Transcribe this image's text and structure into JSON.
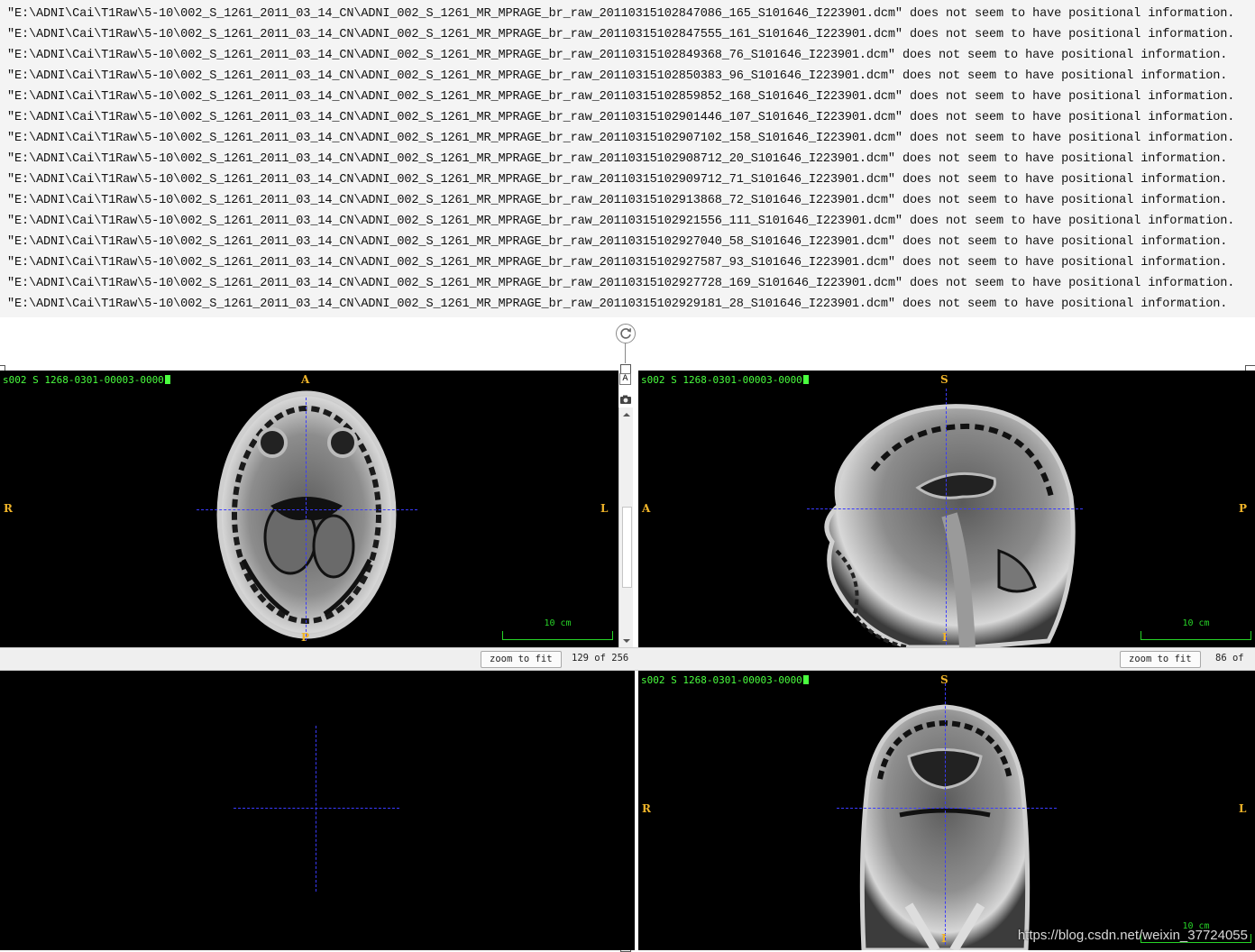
{
  "log": {
    "lines": [
      "\"E:\\ADNI\\Cai\\T1Raw\\5-10\\002_S_1261_2011_03_14_CN\\ADNI_002_S_1261_MR_MPRAGE_br_raw_20110315102847086_165_S101646_I223901.dcm\" does not seem to have positional information.",
      "\"E:\\ADNI\\Cai\\T1Raw\\5-10\\002_S_1261_2011_03_14_CN\\ADNI_002_S_1261_MR_MPRAGE_br_raw_20110315102847555_161_S101646_I223901.dcm\" does not seem to have positional information.",
      "\"E:\\ADNI\\Cai\\T1Raw\\5-10\\002_S_1261_2011_03_14_CN\\ADNI_002_S_1261_MR_MPRAGE_br_raw_20110315102849368_76_S101646_I223901.dcm\" does not seem to have positional information.",
      "\"E:\\ADNI\\Cai\\T1Raw\\5-10\\002_S_1261_2011_03_14_CN\\ADNI_002_S_1261_MR_MPRAGE_br_raw_20110315102850383_96_S101646_I223901.dcm\" does not seem to have positional information.",
      "\"E:\\ADNI\\Cai\\T1Raw\\5-10\\002_S_1261_2011_03_14_CN\\ADNI_002_S_1261_MR_MPRAGE_br_raw_20110315102859852_168_S101646_I223901.dcm\" does not seem to have positional information.",
      "\"E:\\ADNI\\Cai\\T1Raw\\5-10\\002_S_1261_2011_03_14_CN\\ADNI_002_S_1261_MR_MPRAGE_br_raw_20110315102901446_107_S101646_I223901.dcm\" does not seem to have positional information.",
      "\"E:\\ADNI\\Cai\\T1Raw\\5-10\\002_S_1261_2011_03_14_CN\\ADNI_002_S_1261_MR_MPRAGE_br_raw_20110315102907102_158_S101646_I223901.dcm\" does not seem to have positional information.",
      "\"E:\\ADNI\\Cai\\T1Raw\\5-10\\002_S_1261_2011_03_14_CN\\ADNI_002_S_1261_MR_MPRAGE_br_raw_20110315102908712_20_S101646_I223901.dcm\" does not seem to have positional information.",
      "\"E:\\ADNI\\Cai\\T1Raw\\5-10\\002_S_1261_2011_03_14_CN\\ADNI_002_S_1261_MR_MPRAGE_br_raw_20110315102909712_71_S101646_I223901.dcm\" does not seem to have positional information.",
      "\"E:\\ADNI\\Cai\\T1Raw\\5-10\\002_S_1261_2011_03_14_CN\\ADNI_002_S_1261_MR_MPRAGE_br_raw_20110315102913868_72_S101646_I223901.dcm\" does not seem to have positional information.",
      "\"E:\\ADNI\\Cai\\T1Raw\\5-10\\002_S_1261_2011_03_14_CN\\ADNI_002_S_1261_MR_MPRAGE_br_raw_20110315102921556_111_S101646_I223901.dcm\" does not seem to have positional information.",
      "\"E:\\ADNI\\Cai\\T1Raw\\5-10\\002_S_1261_2011_03_14_CN\\ADNI_002_S_1261_MR_MPRAGE_br_raw_20110315102927040_58_S101646_I223901.dcm\" does not seem to have positional information.",
      "\"E:\\ADNI\\Cai\\T1Raw\\5-10\\002_S_1261_2011_03_14_CN\\ADNI_002_S_1261_MR_MPRAGE_br_raw_20110315102927587_93_S101646_I223901.dcm\" does not seem to have positional information.",
      "\"E:\\ADNI\\Cai\\T1Raw\\5-10\\002_S_1261_2011_03_14_CN\\ADNI_002_S_1261_MR_MPRAGE_br_raw_20110315102927728_169_S101646_I223901.dcm\" does not seem to have positional information.",
      "\"E:\\ADNI\\Cai\\T1Raw\\5-10\\002_S_1261_2011_03_14_CN\\ADNI_002_S_1261_MR_MPRAGE_br_raw_20110315102929181_28_S101646_I223901.dcm\" does not seem to have positional information."
    ]
  },
  "toolbar_icons": {
    "sync": "refresh-icon",
    "annotate": "text-icon",
    "snapshot": "camera-icon"
  },
  "viewers": {
    "axial": {
      "series_label": "s002 S 1268-0301-00003-0000",
      "orient_top": "A",
      "orient_bottom": "P",
      "orient_left": "R",
      "orient_right": "L",
      "scale_label": "10 cm",
      "zoom_label": "zoom to fit",
      "slice_text": "129 of 256"
    },
    "sagittal": {
      "series_label": "s002 S 1268-0301-00003-0000",
      "orient_top": "S",
      "orient_bottom": "I",
      "orient_left": "A",
      "orient_right": "P",
      "scale_label": "10 cm",
      "zoom_label": "zoom to fit",
      "slice_text": "86 of"
    },
    "empty": {},
    "coronal": {
      "series_label": "s002 S 1268-0301-00003-0000",
      "orient_top": "S",
      "orient_bottom": "I",
      "orient_left": "R",
      "orient_right": "L",
      "scale_label": "10 cm"
    }
  },
  "watermark": "https://blog.csdn.net/weixin_37724055",
  "colors": {
    "overlay_text": "#4aff3f",
    "orientation": "#f0b429",
    "crosshair": "#3a3aff",
    "scalebar": "#27d427"
  }
}
